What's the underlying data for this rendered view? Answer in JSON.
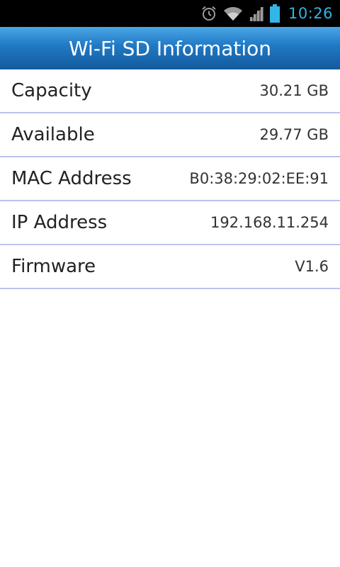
{
  "status_bar": {
    "icons": [
      "alarm-icon",
      "wifi-icon",
      "signal-icon",
      "battery-icon"
    ],
    "time": "10:26",
    "time_color": "#33b5e5"
  },
  "header": {
    "title": "Wi-Fi SD Information"
  },
  "info": {
    "rows": [
      {
        "label": "Capacity",
        "value": "30.21 GB"
      },
      {
        "label": "Available",
        "value": "29.77 GB"
      },
      {
        "label": "MAC Address",
        "value": "B0:38:29:02:EE:91"
      },
      {
        "label": "IP Address",
        "value": "192.168.11.254"
      },
      {
        "label": "Firmware",
        "value": "V1.6"
      }
    ]
  },
  "colors": {
    "header_top": "#4aa6e6",
    "header_bottom": "#145a9c",
    "divider": "#bcc3ee"
  }
}
